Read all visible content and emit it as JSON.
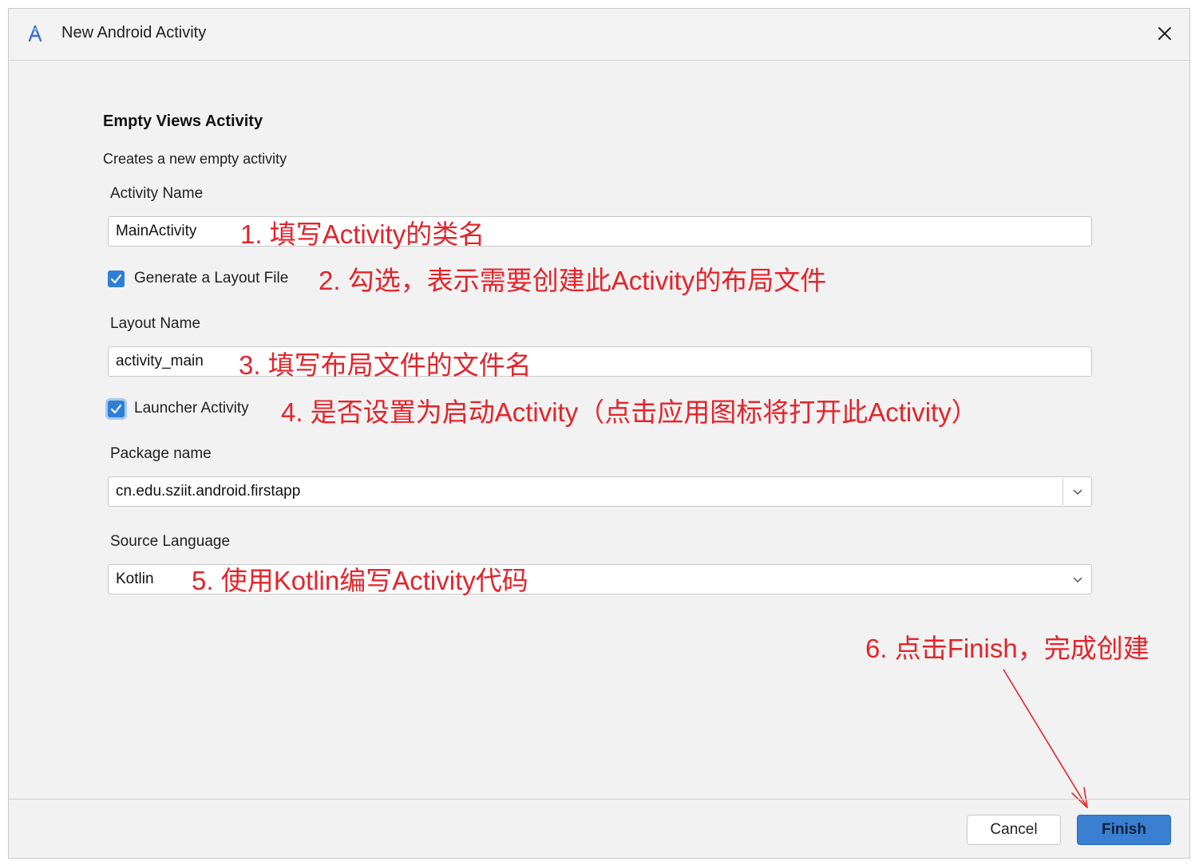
{
  "window": {
    "title": "New Android Activity",
    "app_icon": "android-studio-icon",
    "close_icon": "close-icon"
  },
  "template": {
    "heading": "Empty Views Activity",
    "description": "Creates a new empty activity"
  },
  "form": {
    "activity_name_label": "Activity Name",
    "activity_name_value": "MainActivity",
    "generate_layout_label": "Generate a Layout File",
    "generate_layout_checked": true,
    "layout_name_label": "Layout Name",
    "layout_name_value": "activity_main",
    "launcher_activity_label": "Launcher Activity",
    "launcher_activity_checked": true,
    "package_name_label": "Package name",
    "package_name_value": "cn.edu.sziit.android.firstapp",
    "source_language_label": "Source Language",
    "source_language_value": "Kotlin"
  },
  "buttons": {
    "cancel": "Cancel",
    "finish": "Finish"
  },
  "annotations": {
    "a1": "1. 填写Activity的类名",
    "a2": "2. 勾选，表示需要创建此Activity的布局文件",
    "a3": "3. 填写布局文件的文件名",
    "a4": "4. 是否设置为启动Activity（点击应用图标将打开此Activity）",
    "a5": "5. 使用Kotlin编写Activity代码",
    "a6": "6. 点击Finish，完成创建"
  },
  "colors": {
    "annotation": "#e3242b",
    "accent": "#3a7fd0",
    "checkbox": "#2f7ed8"
  }
}
